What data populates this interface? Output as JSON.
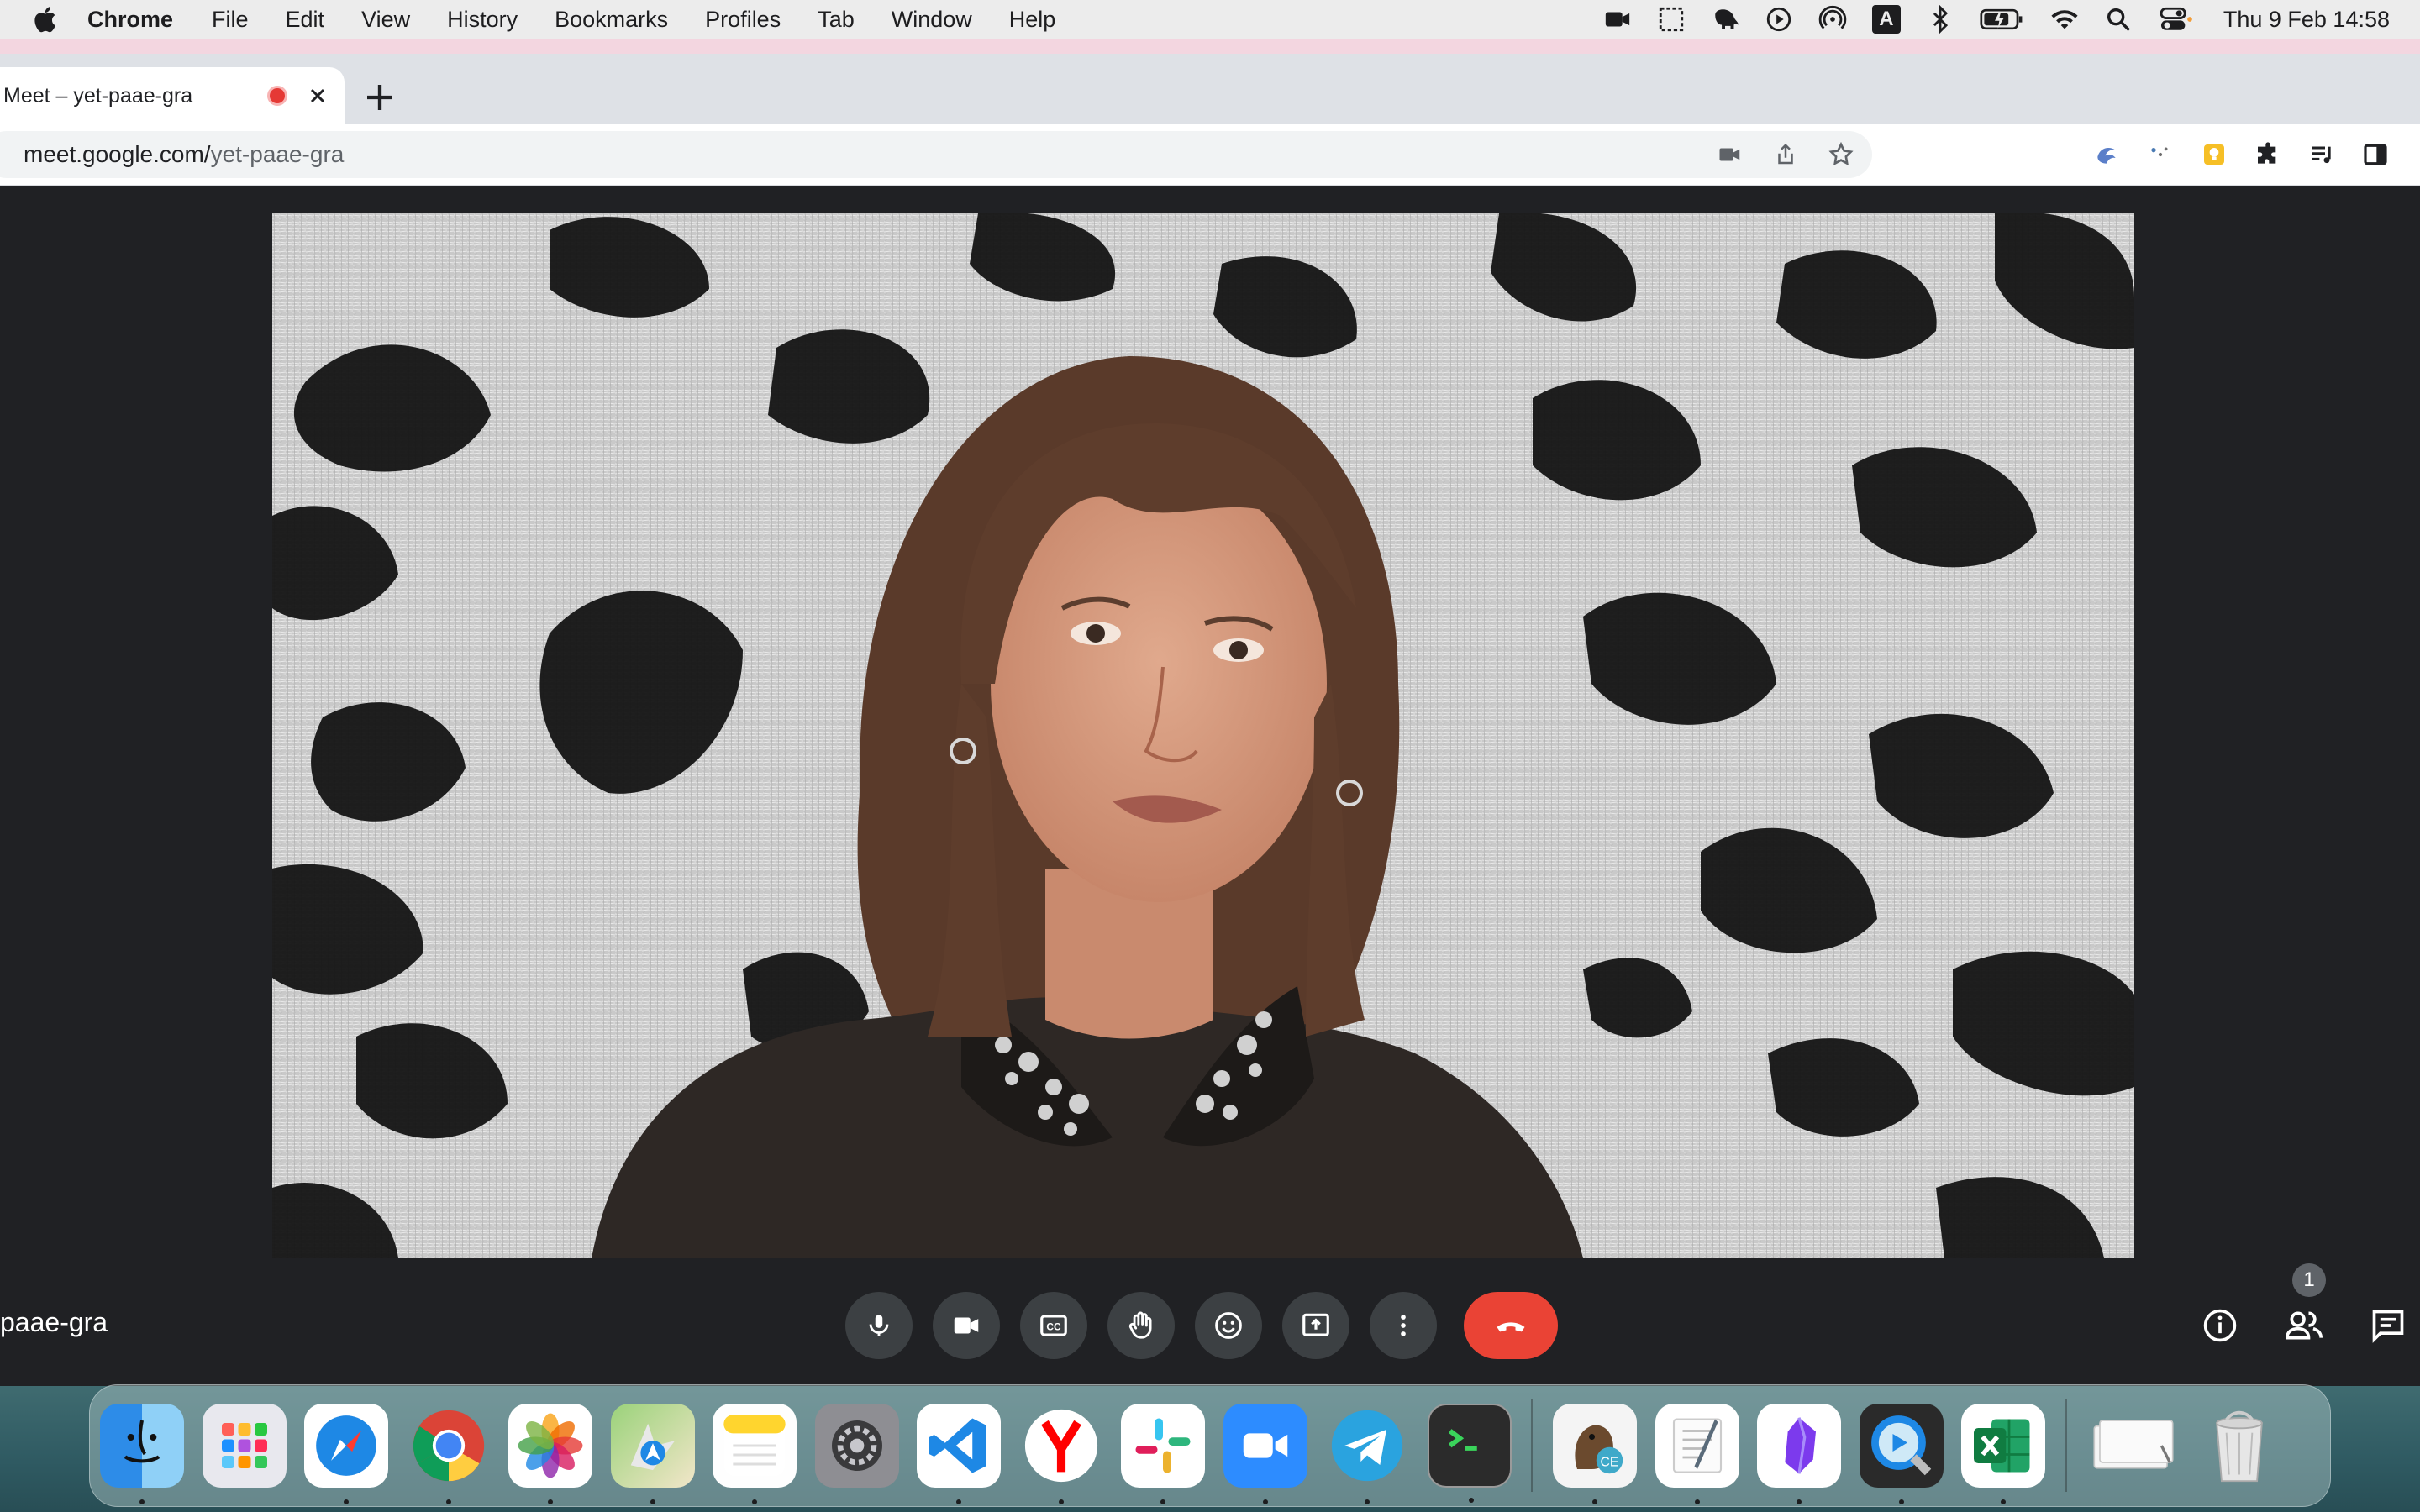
{
  "menubar": {
    "app_name": "Chrome",
    "items": [
      "File",
      "Edit",
      "View",
      "History",
      "Bookmarks",
      "Profiles",
      "Tab",
      "Window",
      "Help"
    ],
    "clock": "Thu 9 Feb  14:58",
    "status_icons": [
      "facetime-icon",
      "screenshot-icon",
      "evernote-icon",
      "play-icon",
      "airdrop-icon",
      "input-source-icon",
      "bluetooth-icon",
      "battery-icon",
      "wifi-icon",
      "spotlight-icon",
      "control-center-icon"
    ],
    "input_source_label": "A"
  },
  "browser": {
    "tab_title": "Meet – yet-paae-gra",
    "url_domain": "meet.google.com/",
    "url_path": "yet-paae-gra"
  },
  "meet": {
    "meeting_code": "paae-gra",
    "participant_count": "1",
    "controls": [
      "microphone",
      "camera",
      "captions",
      "raise-hand",
      "emoji",
      "present",
      "more-options",
      "leave-call"
    ]
  },
  "dock": {
    "apps": [
      "Finder",
      "Launchpad",
      "Safari",
      "Chrome",
      "Photos",
      "Maps",
      "Notes",
      "System Settings",
      "VS Code",
      "Yandex",
      "Slack",
      "Zoom",
      "Telegram",
      "Terminal",
      "CE",
      "TextEdit",
      "Obsidian",
      "QuickTime",
      "Excel"
    ],
    "extra": [
      "Downloads",
      "Trash"
    ]
  },
  "colors": {
    "meet_bg": "#202124",
    "control_bg": "#3c4043",
    "end_call": "#ea4335"
  }
}
